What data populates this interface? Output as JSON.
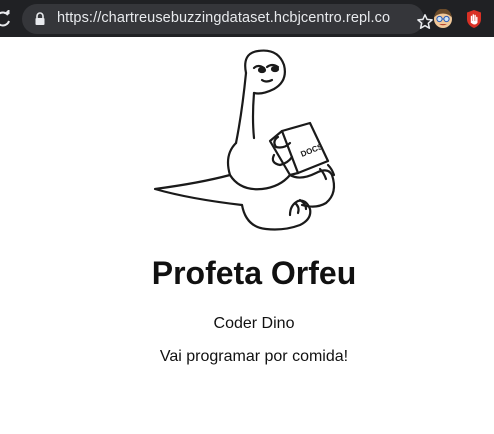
{
  "browser": {
    "url": "https://chartreusebuzzingdataset.hcbjcentro.repl.co"
  },
  "page": {
    "illustration_text": "DOCS",
    "title": "Profeta Orfeu",
    "subtitle": "Coder Dino",
    "tagline": "Vai programar por comida!"
  },
  "icons": {
    "reload": "reload-icon",
    "lock": "lock-icon",
    "bookmark": "star-icon",
    "extension_1": "avatar-extension-icon",
    "extension_2": "hand-extension-icon"
  }
}
